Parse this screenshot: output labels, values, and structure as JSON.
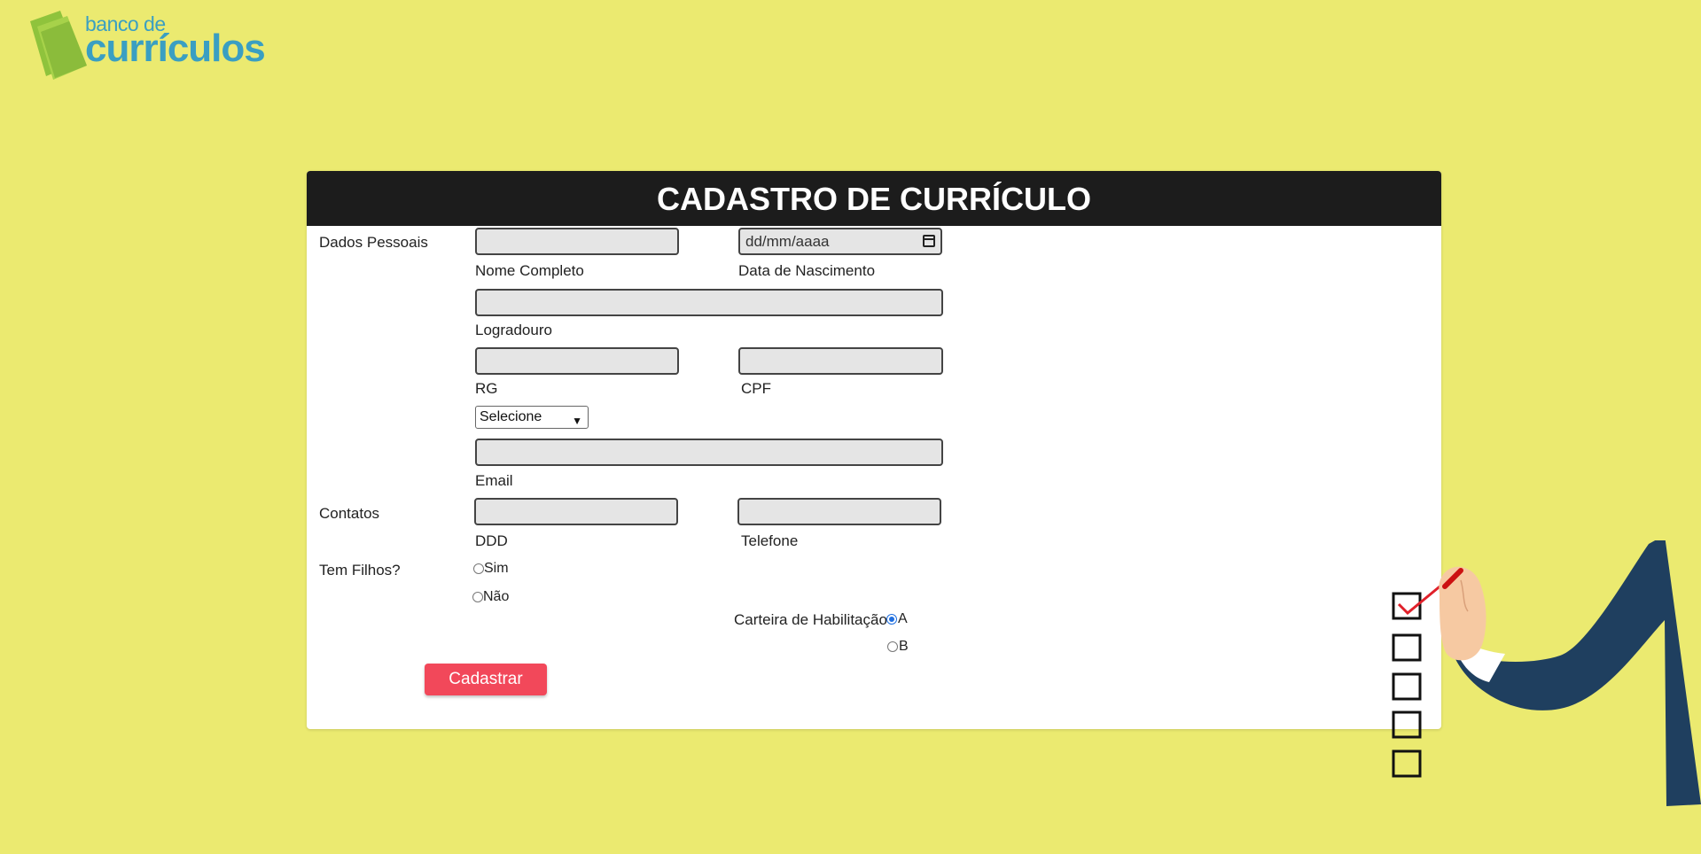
{
  "brand": {
    "line1": "banco de",
    "line2": "currículos",
    "colors": {
      "text": "#3a9fc2",
      "book": "#8fc33c"
    }
  },
  "form": {
    "title": "CADASTRO DE CURRÍCULO",
    "sections": {
      "personal": "Dados Pessoais",
      "contacts": "Contatos",
      "children": "Tem Filhos?"
    },
    "fields": {
      "full_name": {
        "label": "Nome Completo",
        "value": ""
      },
      "birth_date": {
        "label": "Data de Nascimento",
        "value": "dd/mm/aaaa"
      },
      "street": {
        "label": "Logradouro",
        "value": ""
      },
      "rg": {
        "label": "RG",
        "value": ""
      },
      "cpf": {
        "label": "CPF",
        "value": ""
      },
      "select": {
        "value": "Selecione"
      },
      "email": {
        "label": "Email",
        "value": ""
      },
      "ddd": {
        "label": "DDD",
        "value": ""
      },
      "phone": {
        "label": "Telefone",
        "value": ""
      }
    },
    "children_options": [
      {
        "label": "Sim",
        "selected": false
      },
      {
        "label": "Não",
        "selected": false
      }
    ],
    "license": {
      "label": "Carteira de Habilitação?",
      "options": [
        {
          "label": "A",
          "selected": true
        },
        {
          "label": "B",
          "selected": false
        }
      ]
    },
    "submit_label": "Cadastrar"
  },
  "colors": {
    "background": "#ebea70",
    "header": "#1c1c1c",
    "button": "#f2485a",
    "field_bg": "#e5e5e5",
    "jacket": "#1f3f5f"
  }
}
